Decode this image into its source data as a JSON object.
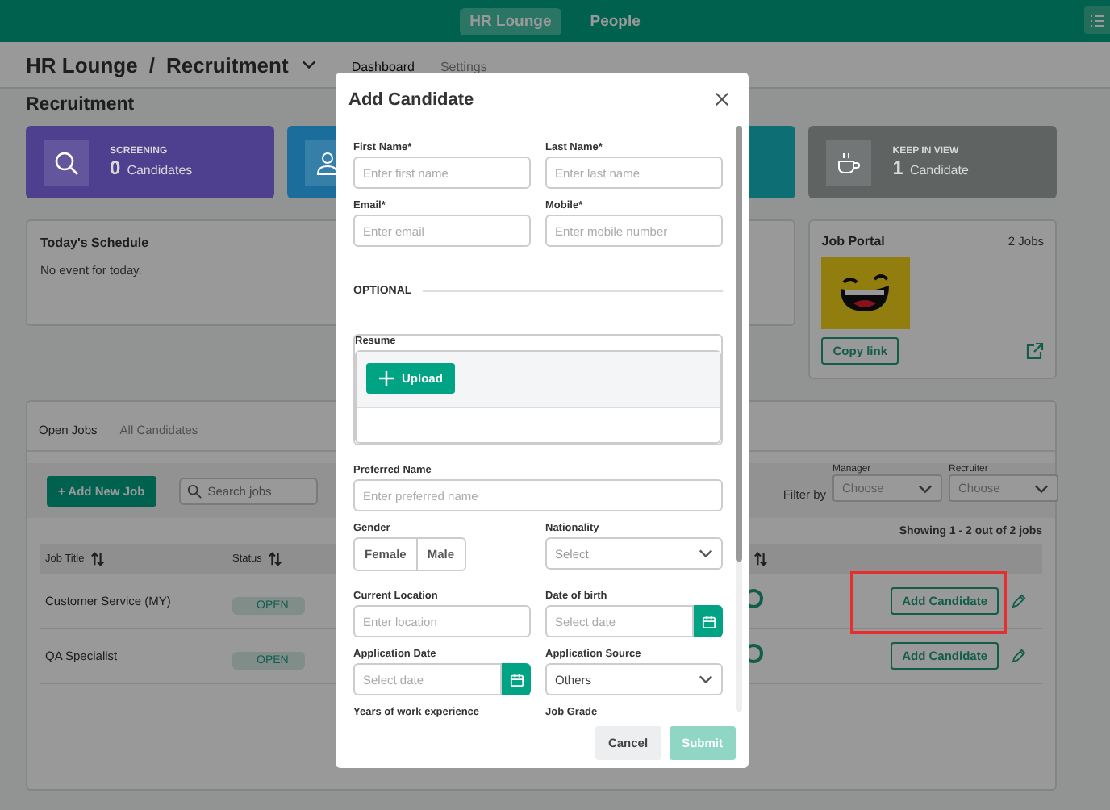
{
  "top_nav": {
    "tabs": [
      {
        "label": "HR Lounge",
        "selected": true
      },
      {
        "label": "People",
        "selected": false
      }
    ]
  },
  "breadcrumb": {
    "parent": "HR Lounge",
    "separator": "/",
    "current": "Recruitment"
  },
  "page_tabs": [
    {
      "label": "Dashboard",
      "selected": true
    },
    {
      "label": "Settings",
      "selected": false
    }
  ],
  "heading": "Recruitment",
  "stat_cards": [
    {
      "label": "SCREENING",
      "count": "0",
      "unit": "Candidates",
      "color": "#4f3f8f"
    },
    {
      "color": "#1b6e9c"
    },
    {
      "color": "#0d6e73"
    },
    {
      "label": "KEEP IN VIEW",
      "count": "1",
      "unit": "Candidate",
      "color": "#5f6463"
    }
  ],
  "schedule": {
    "title": "Today's Schedule",
    "message": "No event for today."
  },
  "job_portal": {
    "title": "Job Portal",
    "count": "2 Jobs",
    "button": "Copy link"
  },
  "jobs": {
    "tabs": [
      {
        "label": "Open Jobs",
        "selected": true
      },
      {
        "label": "All Candidates",
        "selected": false
      }
    ],
    "add_button": "+ Add New Job",
    "search": {
      "placeholder": "Search jobs"
    },
    "filter_label": "Filter by",
    "filters": [
      {
        "label": "Manager",
        "placeholder": "Choose"
      },
      {
        "label": "Recruiter",
        "placeholder": "Choose"
      }
    ],
    "summary": "Showing 1 - 2 out of 2 jobs",
    "table": {
      "columns": [
        "Job Title",
        "Status"
      ],
      "rows": [
        {
          "title": "Customer Service (MY)",
          "status": "OPEN",
          "action": "Add Candidate",
          "highlighted": true
        },
        {
          "title": "QA Specialist",
          "status": "OPEN",
          "action": "Add Candidate",
          "highlighted": false
        }
      ]
    }
  },
  "modal": {
    "title": "Add Candidate",
    "rows": [
      {
        "fields": [
          {
            "kind": "text",
            "label": "First Name*",
            "placeholder": "Enter first name"
          },
          {
            "kind": "text",
            "label": "Last Name*",
            "placeholder": "Enter last name"
          }
        ]
      },
      {
        "fields": [
          {
            "kind": "text",
            "label": "Email*",
            "placeholder": "Enter email"
          },
          {
            "kind": "text",
            "label": "Mobile*",
            "placeholder": "Enter mobile number"
          }
        ]
      },
      {
        "fields": [
          {
            "kind": "section",
            "label": "OPTIONAL"
          }
        ]
      },
      {
        "fields": [
          {
            "kind": "upload",
            "label": "Resume",
            "button": "Upload"
          }
        ]
      },
      {
        "fields": [
          {
            "kind": "text",
            "label": "Preferred Name",
            "placeholder": "Enter preferred name"
          }
        ]
      },
      {
        "fields": [
          {
            "kind": "segmented",
            "label": "Gender",
            "options": [
              {
                "label": "Female",
                "selected": false
              },
              {
                "label": "Male",
                "selected": false
              }
            ]
          },
          {
            "kind": "select",
            "label": "Nationality",
            "placeholder": "Select"
          }
        ]
      },
      {
        "fields": [
          {
            "kind": "text",
            "label": "Current Location",
            "placeholder": "Enter location"
          },
          {
            "kind": "date",
            "label": "Date of birth",
            "placeholder": "Select date"
          }
        ]
      },
      {
        "fields": [
          {
            "kind": "date",
            "label": "Application Date",
            "placeholder": "Select date"
          },
          {
            "kind": "select",
            "label": "Application Source",
            "value": "Others"
          }
        ]
      },
      {
        "fields": [
          {
            "kind": "label",
            "label": "Years of work experience"
          },
          {
            "kind": "label",
            "label": "Job Grade"
          }
        ]
      }
    ],
    "buttons": [
      {
        "label": "Cancel",
        "disabled": false
      },
      {
        "label": "Submit",
        "disabled": true
      }
    ]
  }
}
